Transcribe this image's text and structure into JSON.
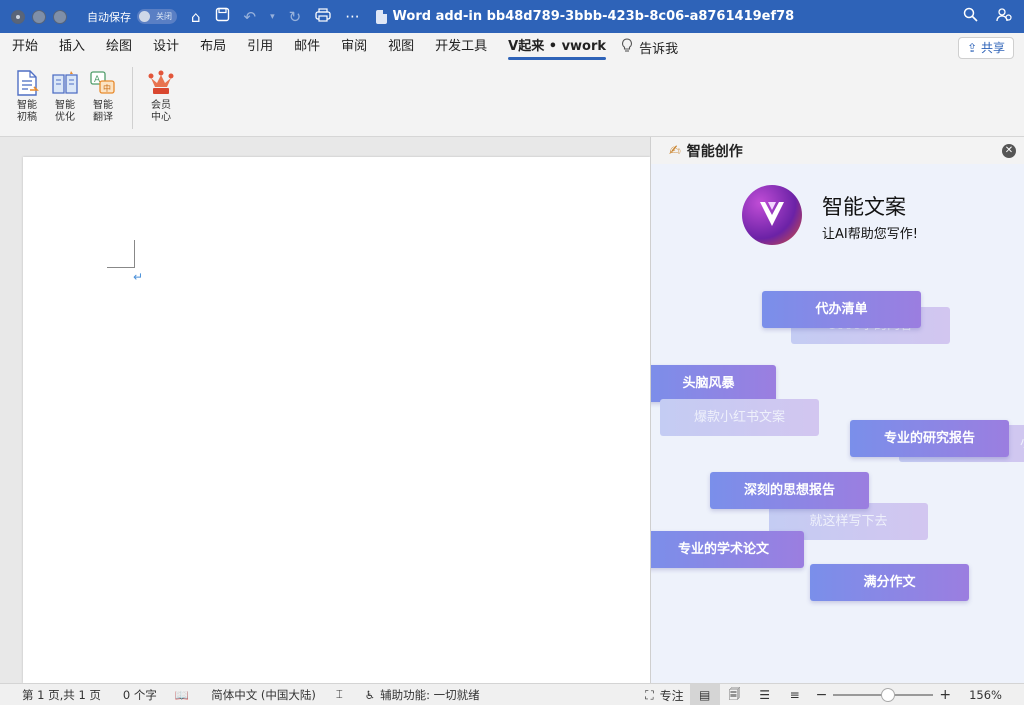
{
  "titlebar": {
    "autosave_label": "自动保存",
    "autosave_state": "关闭",
    "doc_title": "Word add-in bb48d789-3bbb-423b-8c06-a8761419ef78"
  },
  "tabs": [
    {
      "label": "开始"
    },
    {
      "label": "插入"
    },
    {
      "label": "绘图"
    },
    {
      "label": "设计"
    },
    {
      "label": "布局"
    },
    {
      "label": "引用"
    },
    {
      "label": "邮件"
    },
    {
      "label": "审阅"
    },
    {
      "label": "视图"
    },
    {
      "label": "开发工具"
    },
    {
      "label": "V起来 • vwork",
      "active": true
    }
  ],
  "tell_me": "告诉我",
  "share_label": "共享",
  "ribbon": {
    "btn1_line1": "智能",
    "btn1_line2": "初稿",
    "btn2_line1": "智能",
    "btn2_line2": "优化",
    "btn3_line1": "智能",
    "btn3_line2": "翻译",
    "btn4_line1": "会员",
    "btn4_line2": "中心"
  },
  "pane": {
    "title": "智能创作",
    "hero_title": "智能文案",
    "hero_sub": "让AI帮助您写作!",
    "chips": {
      "todo": "代办清单",
      "todo_ghost": "1000字的内容",
      "brainstorm": "头脑风暴",
      "xhs": "爆款小红书文案",
      "research": "专业的研究报告",
      "research_ghost": "小",
      "thought": "深刻的思想报告",
      "writedown": "就这样写下去",
      "academic": "专业的学术论文",
      "essay": "满分作文"
    }
  },
  "status": {
    "page": "第 1 页,共 1 页",
    "words": "0 个字",
    "language": "简体中文 (中国大陆)",
    "accessibility": "辅助功能: 一切就绪",
    "focus": "专注",
    "zoom": "156%"
  },
  "colors": {
    "titlebar": "#2e63b8",
    "chip_start": "#7a8fea",
    "chip_end": "#9b7ee0"
  }
}
